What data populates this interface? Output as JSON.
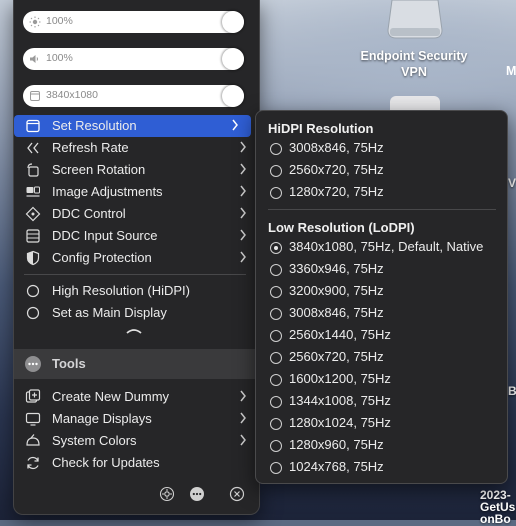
{
  "desktop": {
    "icon_label_line1": "Endpoint Security",
    "icon_label_line2": "VPN",
    "partial_letter": "M",
    "partial_v": "V",
    "partial_b": "B",
    "partial_year": "2023-",
    "partial_getus": "GetUs",
    "partial_onbo": "onBo"
  },
  "sliders": {
    "brightness": {
      "text": "100%",
      "level": 1.0,
      "icon": "sun-icon"
    },
    "volume": {
      "text": "100%",
      "level": 1.0,
      "icon": "speaker-icon"
    },
    "resolution": {
      "text": "3840x1080",
      "level": 1.0,
      "icon": "display-icon"
    }
  },
  "menu": {
    "items": [
      {
        "label": "Set Resolution",
        "icon": "display-icon",
        "submenu": true,
        "selected": true
      },
      {
        "label": "Refresh Rate",
        "icon": "refresh-rate-icon",
        "submenu": true
      },
      {
        "label": "Screen Rotation",
        "icon": "rotation-icon",
        "submenu": true
      },
      {
        "label": "Image Adjustments",
        "icon": "adjustments-icon",
        "submenu": true
      },
      {
        "label": "DDC Control",
        "icon": "ddc-control-icon",
        "submenu": true
      },
      {
        "label": "DDC Input Source",
        "icon": "input-source-icon",
        "submenu": true
      },
      {
        "label": "Config Protection",
        "icon": "shield-icon",
        "submenu": true
      }
    ],
    "toggles": [
      {
        "label": "High Resolution (HiDPI)",
        "checked": false
      },
      {
        "label": "Set as Main Display",
        "checked": false
      }
    ],
    "tools_label": "Tools",
    "tool_items": [
      {
        "label": "Create New Dummy",
        "icon": "add-display-icon",
        "submenu": true
      },
      {
        "label": "Manage Displays",
        "icon": "monitor-icon",
        "submenu": true
      },
      {
        "label": "System Colors",
        "icon": "colors-icon",
        "submenu": true
      },
      {
        "label": "Check for Updates",
        "icon": "update-icon",
        "submenu": false
      }
    ]
  },
  "submenu": {
    "hidpi_heading": "HiDPI Resolution",
    "hidpi": [
      {
        "label": "3008x846, 75Hz",
        "selected": false
      },
      {
        "label": "2560x720, 75Hz",
        "selected": false
      },
      {
        "label": "1280x720, 75Hz",
        "selected": false
      }
    ],
    "lodpi_heading": "Low Resolution (LoDPI)",
    "lodpi": [
      {
        "label": "3840x1080, 75Hz, Default, Native",
        "selected": true
      },
      {
        "label": "3360x946, 75Hz",
        "selected": false
      },
      {
        "label": "3200x900, 75Hz",
        "selected": false
      },
      {
        "label": "3008x846, 75Hz",
        "selected": false
      },
      {
        "label": "2560x1440, 75Hz",
        "selected": false
      },
      {
        "label": "2560x720, 75Hz",
        "selected": false
      },
      {
        "label": "1600x1200, 75Hz",
        "selected": false
      },
      {
        "label": "1344x1008, 75Hz",
        "selected": false
      },
      {
        "label": "1280x1024, 75Hz",
        "selected": false
      },
      {
        "label": "1280x960, 75Hz",
        "selected": false
      },
      {
        "label": "1024x768, 75Hz",
        "selected": false
      }
    ]
  },
  "colors": {
    "accent": "#2f5ed4",
    "menu_bg": "#262628"
  }
}
